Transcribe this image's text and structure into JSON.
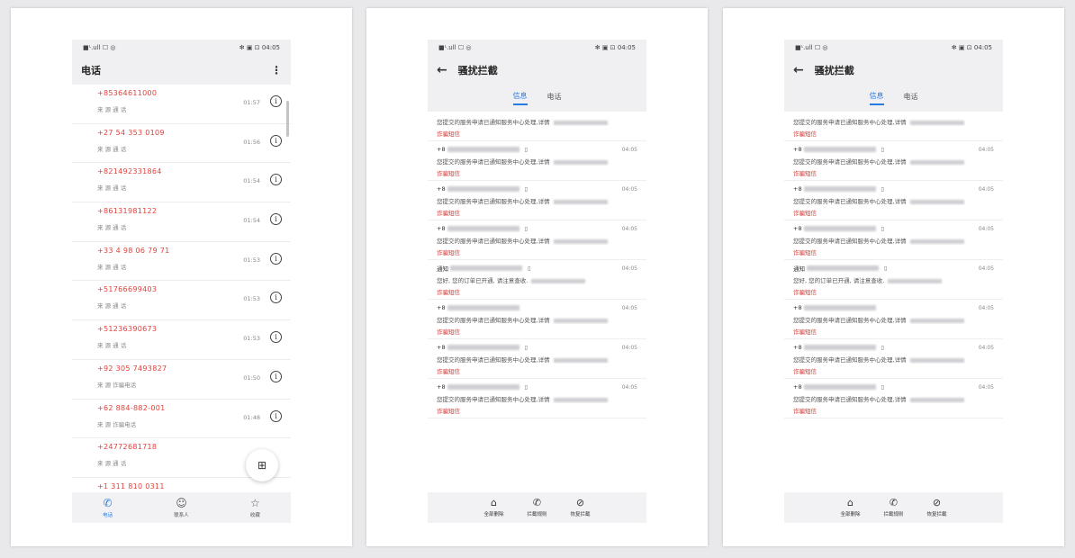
{
  "status": {
    "left": "■ᴸ.ull ☐ ◎",
    "right": "✻ ▣ ⊡ 04:05"
  },
  "calls_screen": {
    "title": "电话",
    "calls": [
      {
        "number": "+85364611000",
        "sub": "来 源 通 话",
        "time": "01:57"
      },
      {
        "number": "+27 54 353 0109",
        "sub": "来 源 通 话",
        "time": "01:56"
      },
      {
        "number": "+821492331864",
        "sub": "来 源 通 话",
        "time": "01:54"
      },
      {
        "number": "+86131981122",
        "sub": "来 源 通 话",
        "time": "01:54"
      },
      {
        "number": "+33 4 98 06 79 71",
        "sub": "来 源 通 话",
        "time": "01:53"
      },
      {
        "number": "+51766699403",
        "sub": "来 源 通 话",
        "time": "01:53"
      },
      {
        "number": "+51236390673",
        "sub": "来 源 通 话",
        "time": "01:53"
      },
      {
        "number": "+92 305 7493827",
        "sub": "来 源 诈骗电话",
        "time": "01:50"
      },
      {
        "number": "+62 884-882-001",
        "sub": "来 源 诈骗电话",
        "time": "01:48"
      },
      {
        "number": "+24772681718",
        "sub": "来 源 通 话",
        "time": ""
      },
      {
        "number": "+1 311 810 0311",
        "sub": "",
        "time": ""
      }
    ],
    "fab_label": "⊞",
    "nav": [
      {
        "icon": "✆",
        "label": "电话",
        "active": true
      },
      {
        "icon": "☺",
        "label": "联系人",
        "active": false
      },
      {
        "icon": "☆",
        "label": "收藏",
        "active": false
      }
    ]
  },
  "intercept_screen": {
    "title": "骚扰拦截",
    "tabs": [
      {
        "label": "信息",
        "active": true
      },
      {
        "label": "电话",
        "active": false
      }
    ],
    "messages": [
      {
        "sender": "",
        "sim": "",
        "time": "",
        "body": "您提交的服务申请已通知服务中心处理,详情",
        "tag": "诈骗短信"
      },
      {
        "sender": "+8",
        "sim": "▯",
        "time": "04:05",
        "body": "您提交的服务申请已通知服务中心处理,详情",
        "tag": "诈骗短信"
      },
      {
        "sender": "+8",
        "sim": "▯",
        "time": "04:05",
        "body": "您提交的服务申请已通知服务中心处理,详情",
        "tag": "诈骗短信"
      },
      {
        "sender": "+8",
        "sim": "▯",
        "time": "04:05",
        "body": "您提交的服务申请已通知服务中心处理,详情",
        "tag": "诈骗短信"
      },
      {
        "sender": "通知",
        "sim": "▯",
        "time": "04:05",
        "body": "您好, 您的订单已开通, 请注意查收.",
        "tag": "诈骗短信"
      },
      {
        "sender": "+8",
        "sim": "",
        "time": "04:05",
        "body": "您提交的服务申请已通知服务中心处理,详情",
        "tag": "诈骗短信"
      },
      {
        "sender": "+8",
        "sim": "▯",
        "time": "04:05",
        "body": "您提交的服务申请已通知服务中心处理,详情",
        "tag": "诈骗短信"
      },
      {
        "sender": "+8",
        "sim": "▯",
        "time": "04:05",
        "body": "您提交的服务申请已通知服务中心处理,详情",
        "tag": "诈骗短信"
      }
    ],
    "actions": [
      {
        "icon": "⌂",
        "label": "全部删除"
      },
      {
        "icon": "✆",
        "label": "拦截规则"
      },
      {
        "icon": "⊘",
        "label": "恢复拦截"
      }
    ]
  }
}
